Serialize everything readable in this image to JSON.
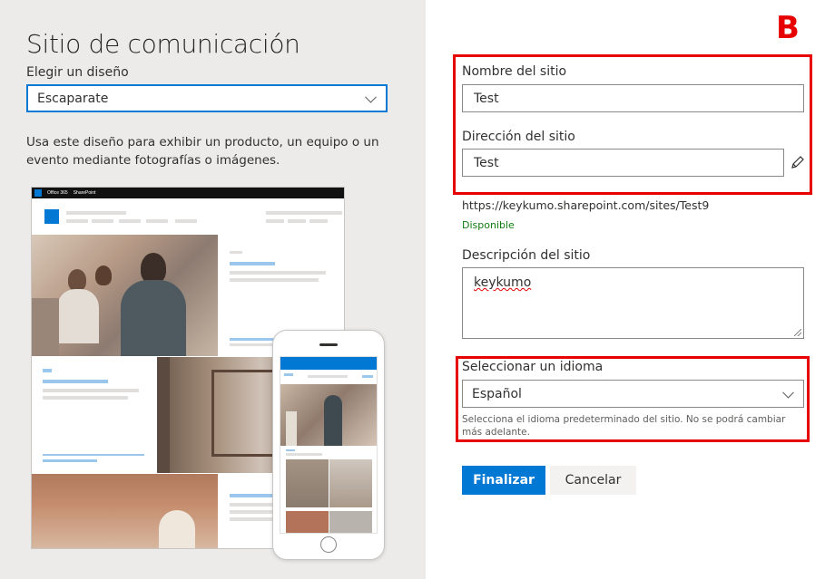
{
  "left_panel": {
    "title": "Sitio de comunicación",
    "design_label": "Elegir un diseño",
    "design_selected": "Escaparate",
    "design_description": "Usa este diseño para exhibir un producto, un equipo o un evento mediante fotografías o imágenes.",
    "preview": {
      "suite_brand": "Office 365",
      "suite_app": "SharePoint"
    }
  },
  "right_panel": {
    "annotation_letter": "B",
    "site_name_label": "Nombre del sitio",
    "site_name_value": "Test",
    "site_address_label": "Dirección del sitio",
    "site_address_value": "Test",
    "site_url": "https://keykumo.sharepoint.com/sites/Test9",
    "availability": "Disponible",
    "site_description_label": "Descripción del sitio",
    "site_description_value": "keykumo",
    "language_label": "Seleccionar un idioma",
    "language_selected": "Español",
    "language_help": "Selecciona el idioma predeterminado del sitio. No se podrá cambiar más adelante.",
    "finish_button": "Finalizar",
    "cancel_button": "Cancelar"
  },
  "colors": {
    "accent": "#0078d4",
    "annotation_red": "#e60000",
    "available_green": "#107c10",
    "left_background": "#edebe9"
  },
  "icons": [
    "chevron-down-icon",
    "pencil-icon",
    "waffle-icon",
    "resize-handle-icon"
  ]
}
